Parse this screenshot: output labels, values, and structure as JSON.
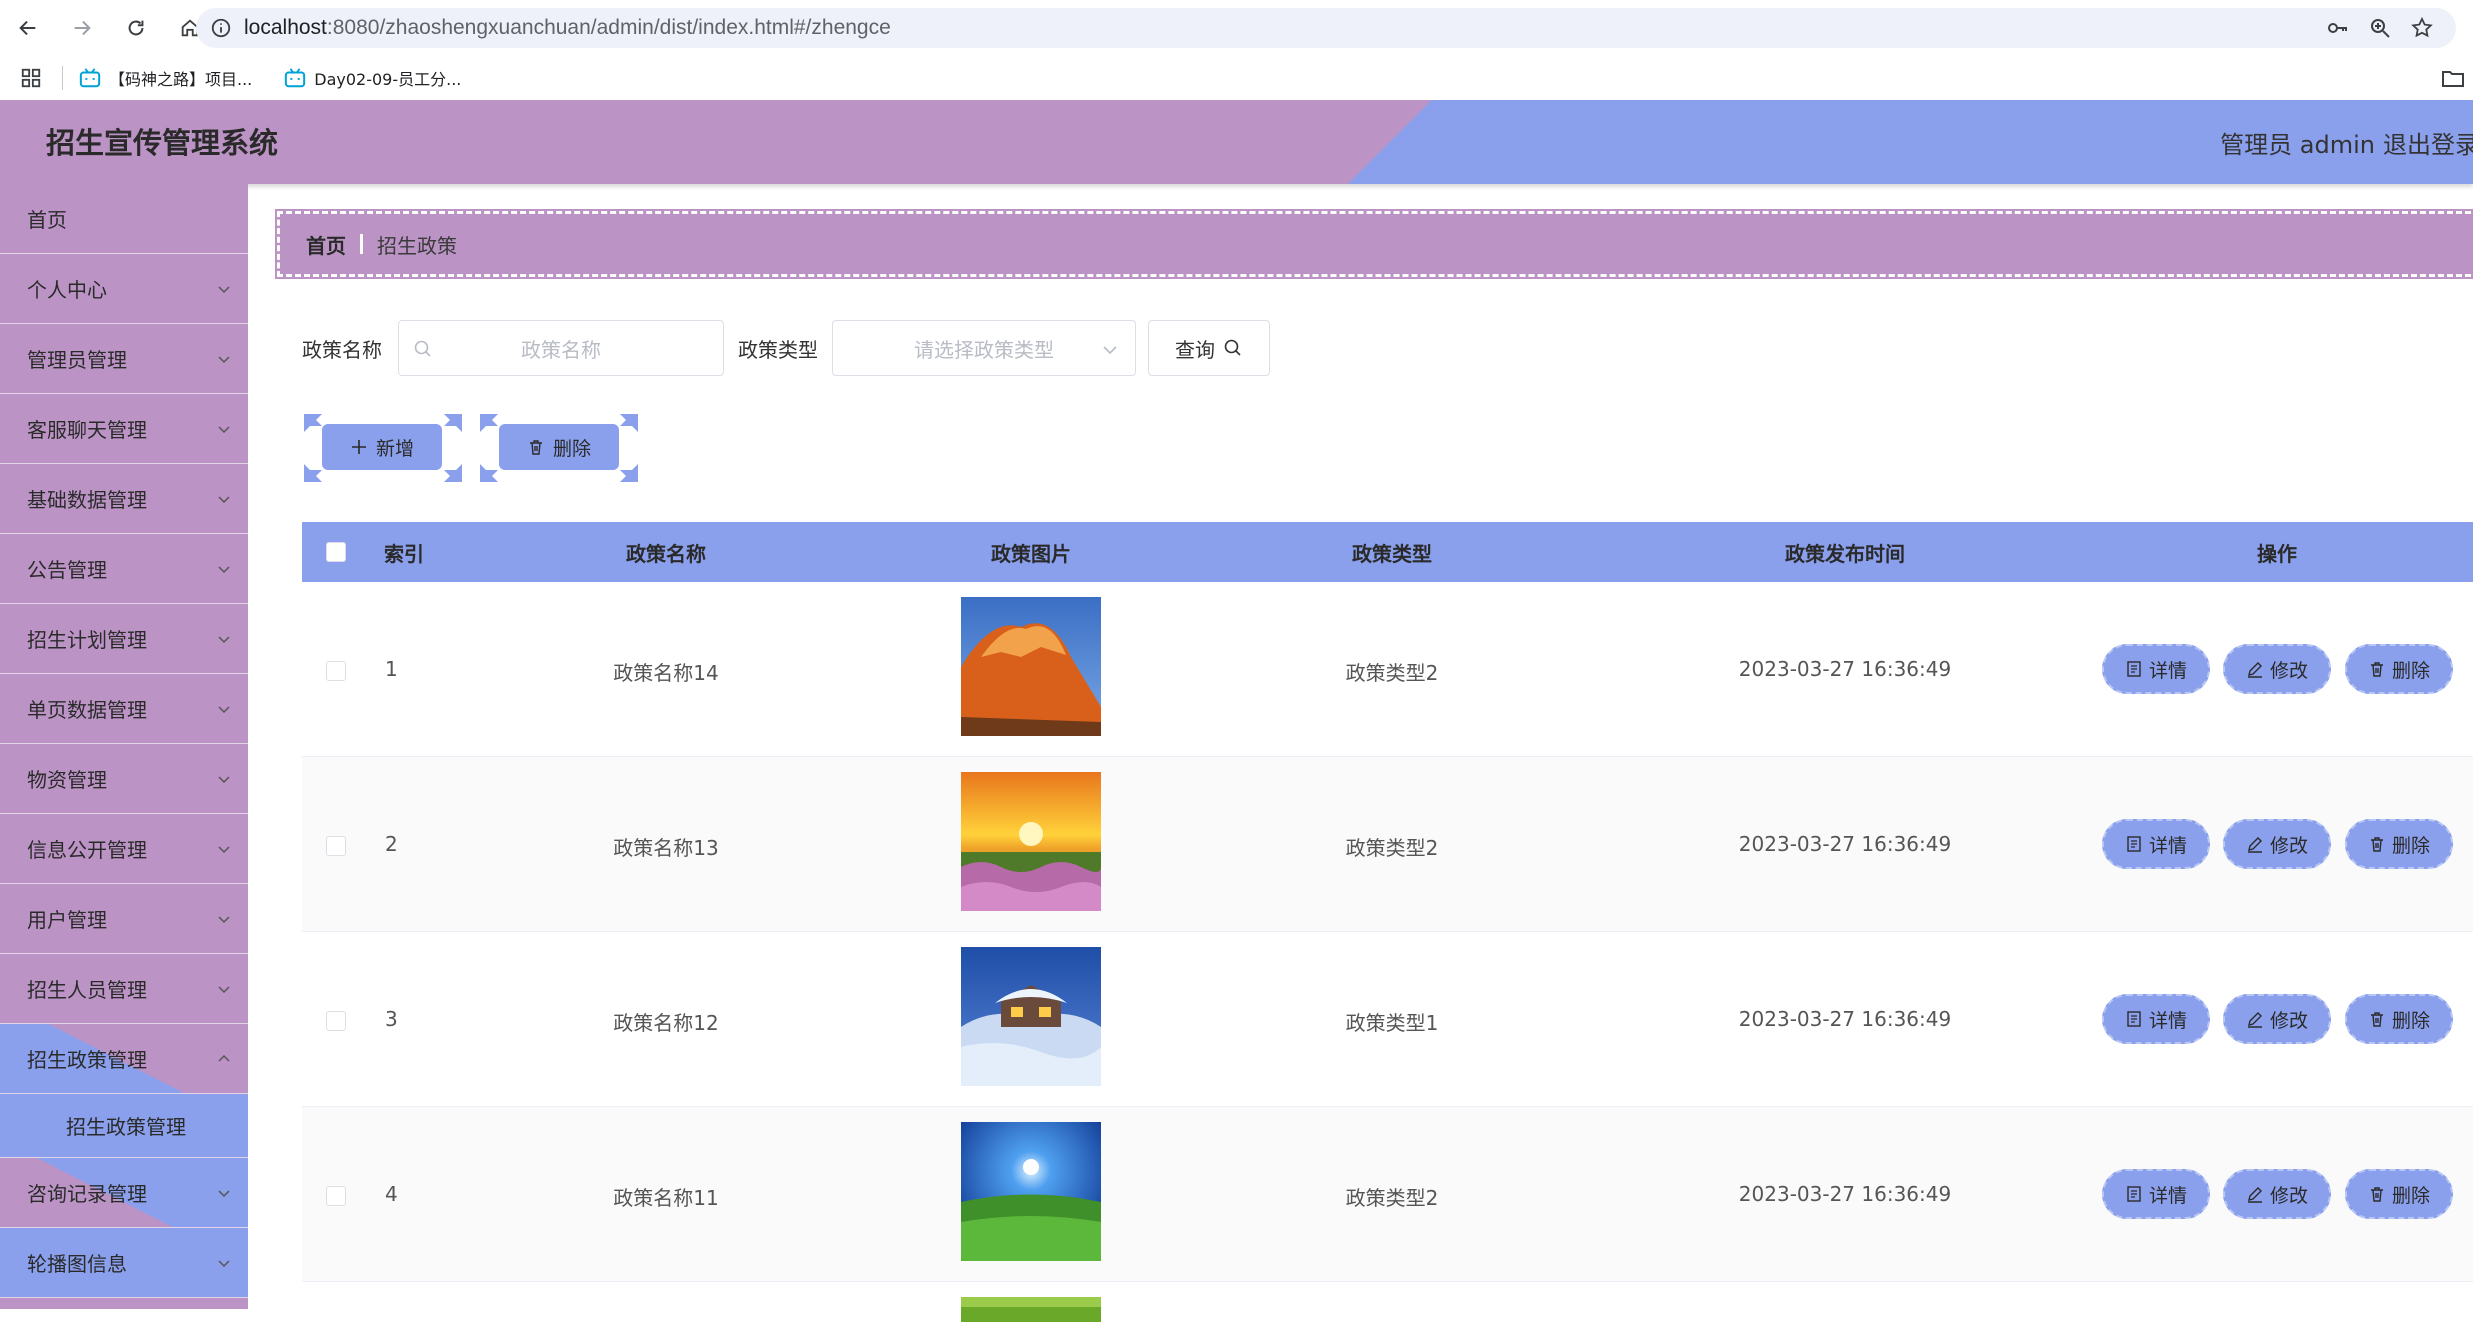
{
  "browser": {
    "url_host": "localhost",
    "url_rest": ":8080/zhaoshengxuanchuan/admin/dist/index.html#/zhengce",
    "bookmarks": [
      "【码神之路】项目...",
      "Day02-09-员工分..."
    ]
  },
  "header": {
    "title": "招生宣传管理系统",
    "user": "管理员 admin",
    "logout": "退出登录"
  },
  "sidebar": {
    "items": [
      {
        "label": "首页",
        "has_children": false
      },
      {
        "label": "个人中心",
        "has_children": true
      },
      {
        "label": "管理员管理",
        "has_children": true
      },
      {
        "label": "客服聊天管理",
        "has_children": true
      },
      {
        "label": "基础数据管理",
        "has_children": true
      },
      {
        "label": "公告管理",
        "has_children": true
      },
      {
        "label": "招生计划管理",
        "has_children": true
      },
      {
        "label": "单页数据管理",
        "has_children": true
      },
      {
        "label": "物资管理",
        "has_children": true
      },
      {
        "label": "信息公开管理",
        "has_children": true
      },
      {
        "label": "用户管理",
        "has_children": true
      },
      {
        "label": "招生人员管理",
        "has_children": true
      },
      {
        "label": "招生政策管理",
        "has_children": true,
        "expanded": true
      },
      {
        "label": "咨询记录管理",
        "has_children": true
      },
      {
        "label": "轮播图信息",
        "has_children": true
      }
    ],
    "active_sub": "招生政策管理"
  },
  "breadcrumb": {
    "home": "首页",
    "current": "招生政策"
  },
  "search": {
    "name_label": "政策名称",
    "name_placeholder": "政策名称",
    "type_label": "政策类型",
    "type_placeholder": "请选择政策类型",
    "query_button": "查询"
  },
  "actions": {
    "add": "新增",
    "delete": "删除"
  },
  "table": {
    "columns": [
      "索引",
      "政策名称",
      "政策图片",
      "政策类型",
      "政策发布时间",
      "操作"
    ],
    "rows": [
      {
        "index": "1",
        "name": "政策名称14",
        "type": "政策类型2",
        "time": "2023-03-27 16:36:49",
        "image": "mountain-sunset"
      },
      {
        "index": "2",
        "name": "政策名称13",
        "type": "政策类型2",
        "time": "2023-03-27 16:36:49",
        "image": "flower-field-sunrise"
      },
      {
        "index": "3",
        "name": "政策名称12",
        "type": "政策类型1",
        "time": "2023-03-27 16:36:49",
        "image": "snow-cabin"
      },
      {
        "index": "4",
        "name": "政策名称11",
        "type": "政策类型2",
        "time": "2023-03-27 16:36:49",
        "image": "meadow-night-sky"
      }
    ],
    "op_buttons": {
      "detail": "详情",
      "edit": "修改",
      "delete": "删除"
    }
  },
  "colors": {
    "purple": "#bb94c5",
    "blue": "#8aa0ec"
  }
}
